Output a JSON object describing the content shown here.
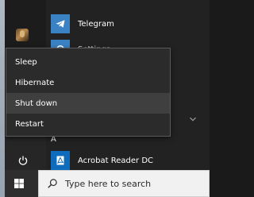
{
  "start_menu": {
    "apps": [
      {
        "label": "Telegram",
        "icon": "telegram-icon"
      },
      {
        "label": "Settings",
        "icon": "settings-icon"
      },
      {
        "label": "Acrobat Reader DC",
        "icon": "acrobat-reader-icon"
      }
    ],
    "letter_header": "A"
  },
  "power_menu": {
    "items": [
      {
        "label": "Sleep"
      },
      {
        "label": "Hibernate"
      },
      {
        "label": "Shut down",
        "highlighted": true
      },
      {
        "label": "Restart"
      }
    ]
  },
  "taskbar": {
    "search_placeholder": "Type here to search"
  },
  "colors": {
    "menu_background": "#2b2b2b",
    "highlight": "#3f3f3f",
    "accent_blue": "#3b82c4",
    "acrobat_tile": "#0f6cbd",
    "taskbar": "#1b1b1b"
  }
}
